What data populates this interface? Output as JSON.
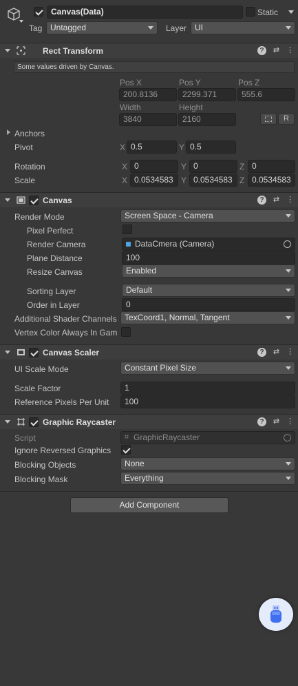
{
  "object": {
    "name": "Canvas(Data)",
    "static_label": "Static",
    "tag_label": "Tag",
    "tag_value": "Untagged",
    "layer_label": "Layer",
    "layer_value": "UI"
  },
  "rect_transform": {
    "title": "Rect Transform",
    "info": "Some values driven by Canvas.",
    "pos_x_label": "Pos X",
    "pos_y_label": "Pos Y",
    "pos_z_label": "Pos Z",
    "pos_x": "200.8136",
    "pos_y": "2299.371",
    "pos_z": "555.6",
    "width_label": "Width",
    "height_label": "Height",
    "width": "3840",
    "height": "2160",
    "r_button": "R",
    "anchors_label": "Anchors",
    "pivot_label": "Pivot",
    "pivot_x": "0.5",
    "pivot_y": "0.5",
    "rotation_label": "Rotation",
    "rot_x": "0",
    "rot_y": "0",
    "rot_z": "0",
    "scale_label": "Scale",
    "scale_x": "0.0534583",
    "scale_y": "0.0534583",
    "scale_z": "0.0534583",
    "x": "X",
    "y": "Y",
    "z": "Z"
  },
  "canvas": {
    "title": "Canvas",
    "render_mode_label": "Render Mode",
    "render_mode": "Screen Space - Camera",
    "pixel_perfect_label": "Pixel Perfect",
    "render_camera_label": "Render Camera",
    "render_camera": "DataCmera (Camera)",
    "plane_distance_label": "Plane Distance",
    "plane_distance": "100",
    "resize_canvas_label": "Resize Canvas",
    "resize_canvas": "Enabled",
    "sorting_layer_label": "Sorting Layer",
    "sorting_layer": "Default",
    "order_label": "Order in Layer",
    "order": "0",
    "shader_channels_label": "Additional Shader Channels",
    "shader_channels": "TexCoord1, Normal, Tangent",
    "vertex_color_label": "Vertex Color Always In Gam"
  },
  "canvas_scaler": {
    "title": "Canvas Scaler",
    "scale_mode_label": "UI Scale Mode",
    "scale_mode": "Constant Pixel Size",
    "scale_factor_label": "Scale Factor",
    "scale_factor": "1",
    "ref_pixels_label": "Reference Pixels Per Unit",
    "ref_pixels": "100"
  },
  "raycaster": {
    "title": "Graphic Raycaster",
    "script_label": "Script",
    "script": "GraphicRaycaster",
    "ignore_reversed_label": "Ignore Reversed Graphics",
    "blocking_objects_label": "Blocking Objects",
    "blocking_objects": "None",
    "blocking_mask_label": "Blocking Mask",
    "blocking_mask": "Everything"
  },
  "add_component": "Add Component"
}
